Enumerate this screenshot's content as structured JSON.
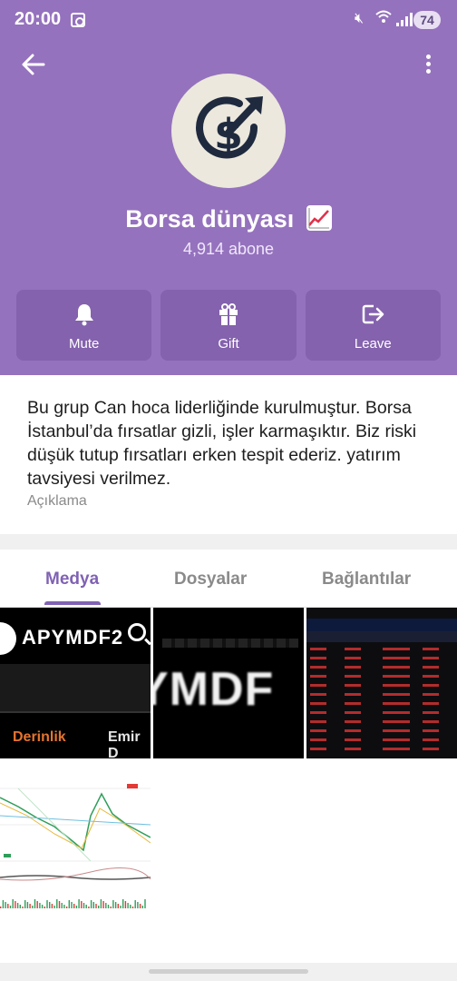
{
  "status_bar": {
    "time": "20:00",
    "battery": "74"
  },
  "header": {
    "channel_name": "Borsa dünyası",
    "subscribers": "4,914 abone",
    "accent_color": "#9572bd"
  },
  "actions": [
    {
      "label": "Mute",
      "icon": "bell-icon"
    },
    {
      "label": "Gift",
      "icon": "gift-icon"
    },
    {
      "label": "Leave",
      "icon": "leave-icon"
    }
  ],
  "about": {
    "description": "Bu grup Can hoca liderliğinde kurulmuştur. Borsa İstanbul’da fırsatlar gizli, işler karmaşıktır. Biz riski düşük tutup fırsatları erken tespit ederiz. yatırım tavsiyesi verilmez.",
    "caption": "Açıklama"
  },
  "tabs": {
    "items": [
      "Medya",
      "Dosyalar",
      "Bağlantılar"
    ],
    "active": "Medya"
  },
  "media": {
    "thumb1": {
      "code": "APYMDF2",
      "tab_a": "Derinlik",
      "tab_b": "Emir D"
    },
    "thumb2": {
      "text": "YMDF"
    }
  }
}
